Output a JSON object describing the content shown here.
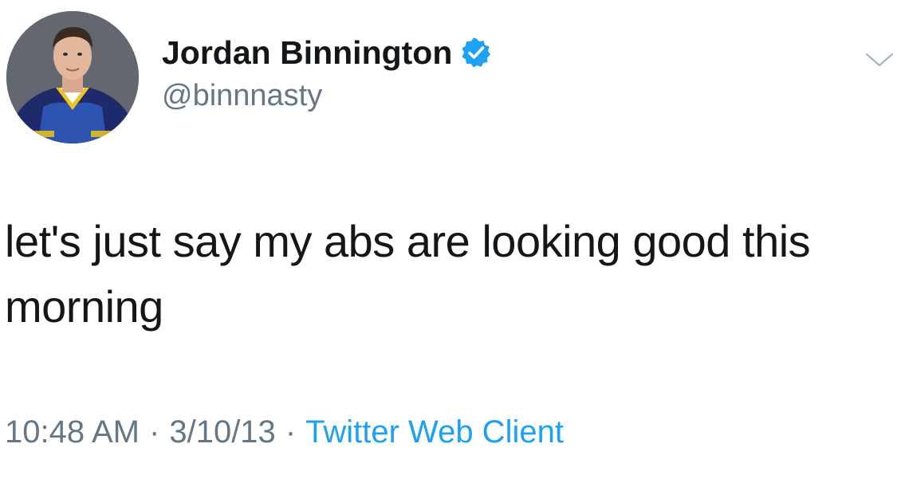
{
  "user": {
    "display_name": "Jordan Binnington",
    "handle": "@binnnasty",
    "verified": true
  },
  "tweet": {
    "text": "let's just say my abs are looking good this morning",
    "time": "10:48 AM",
    "separator": "·",
    "date": "3/10/13",
    "source": "Twitter Web Client"
  },
  "icons": {
    "verified": "verified-badge-icon",
    "menu": "chevron-down-icon"
  },
  "colors": {
    "text": "#14171a",
    "secondary": "#657786",
    "link": "#1da1f2",
    "verified": "#1da1f2"
  }
}
